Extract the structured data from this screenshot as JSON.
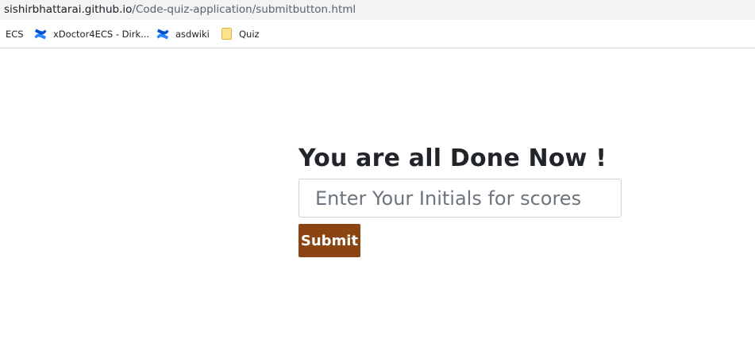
{
  "browser": {
    "url_host": "sishirbhattarai.github.io",
    "url_path": "/Code-quiz-application/submitbutton.html"
  },
  "bookmarks": [
    {
      "label": "ECS",
      "icon": "none"
    },
    {
      "label": "xDoctor4ECS - Dirk...",
      "icon": "confluence-icon"
    },
    {
      "label": "asdwiki",
      "icon": "confluence-icon"
    },
    {
      "label": "Quiz",
      "icon": "folder-icon"
    }
  ],
  "main": {
    "title": "You are all Done Now !",
    "initials_placeholder": "Enter Your Initials for scores",
    "initials_value": "",
    "submit_label": "Submit"
  },
  "colors": {
    "submit_background": "#8b4513",
    "confluence_blue": "#2684ff",
    "address_bar_bg": "#f1f3f4"
  }
}
